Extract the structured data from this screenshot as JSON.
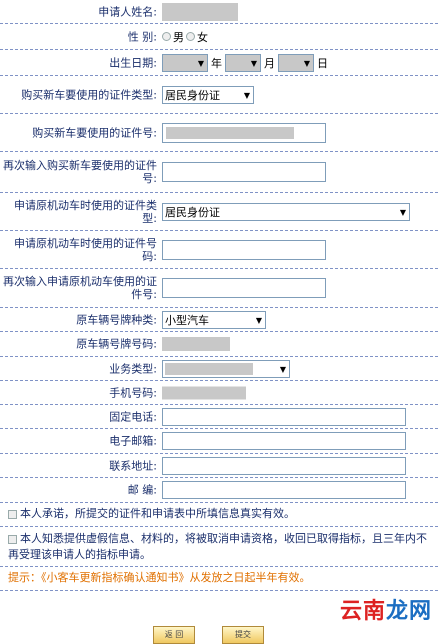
{
  "form": {
    "name_label": "申请人姓名:",
    "gender_label": "性   别:",
    "gender_male": "男",
    "gender_female": "女",
    "dob_label": "出生日期:",
    "dob_year": "年",
    "dob_month": "月",
    "dob_day": "日",
    "id_type_label": "购买新车要使用的证件类型:",
    "id_type_value": "居民身份证",
    "id_number_label": "购买新车要使用的证件号:",
    "id_number_confirm_label": "再次输入购买新车要使用的证件号:",
    "old_id_type_label": "申请原机动车时使用的证件类型:",
    "old_id_type_value": "居民身份证",
    "old_id_number_label": "申请原机动车时使用的证件号码:",
    "old_id_number_confirm_label": "再次输入申请原机动车使用的证件号:",
    "plate_type_label": "原车辆号牌种类:",
    "plate_type_value": "小型汽车",
    "plate_number_label": "原车辆号牌号码:",
    "business_type_label": "业务类型:",
    "mobile_label": "手机号码:",
    "phone_label": "固定电话:",
    "email_label": "电子邮箱:",
    "address_label": "联系地址:",
    "zip_label": "邮   编:"
  },
  "notes": {
    "promise": "本人承诺，所提交的证件和申请表中所填信息真实有效。",
    "warning": "本人知悉提供虚假信息、材料的，将被取消申请资格，收回已取得指标，且三年内不再受理该申请人的指标申请。",
    "tip": "提示：《小客车更新指标确认通知书》从发放之日起半年有效。"
  },
  "buttons": {
    "back": "返 回",
    "submit": "提交"
  },
  "watermark": {
    "part1": "云南",
    "part2": "龙网"
  }
}
